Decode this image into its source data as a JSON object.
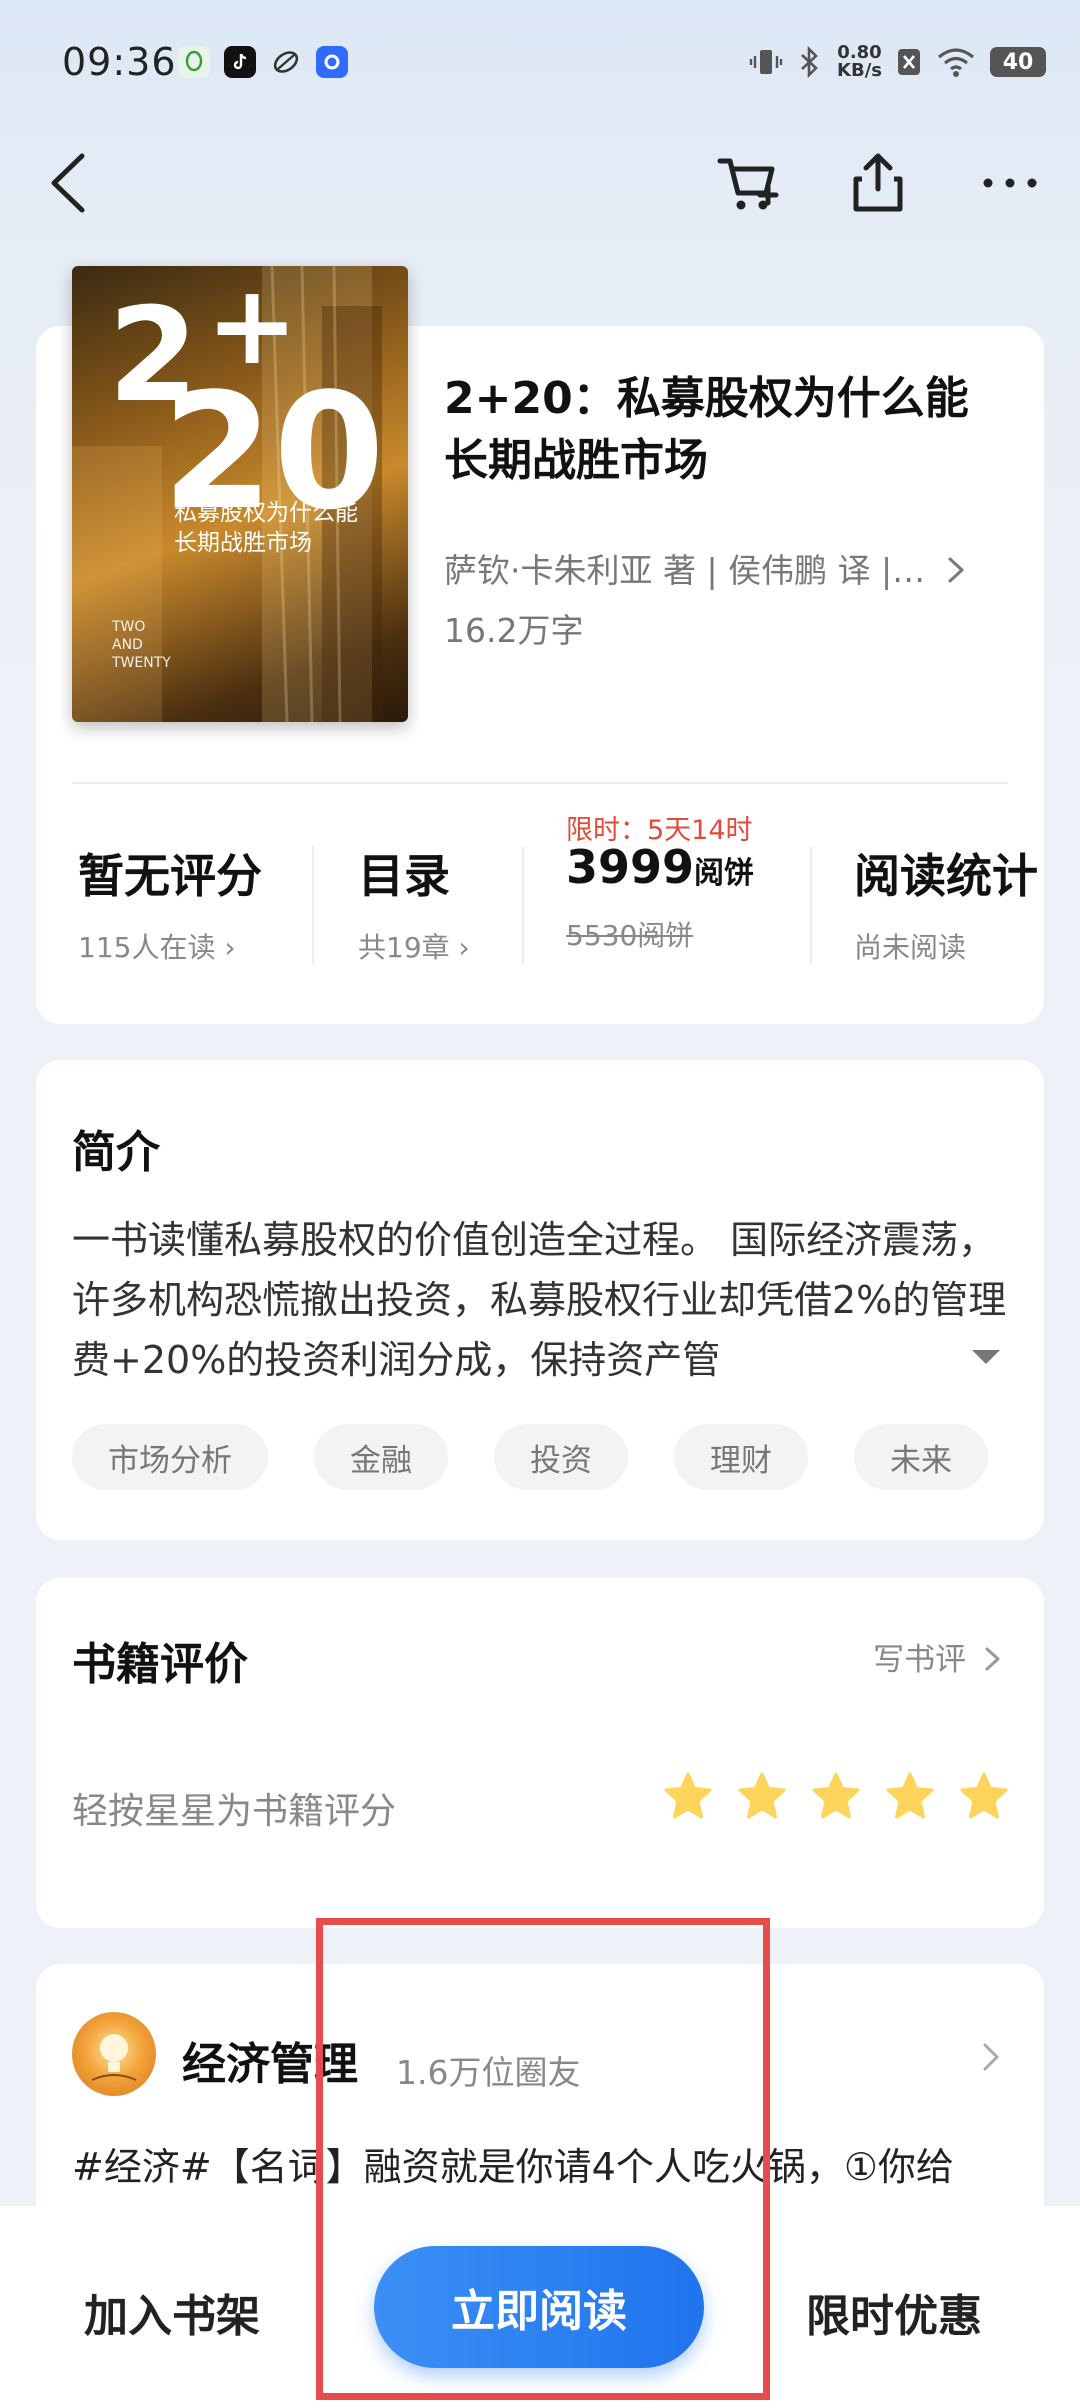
{
  "status_bar": {
    "time": "09:36",
    "net_speed_value": "0.80",
    "net_speed_unit": "KB/s",
    "battery": "40"
  },
  "book": {
    "cover_number_2": "2",
    "cover_plus": "+",
    "cover_number_20": "20",
    "cover_subtitle_line1": "私募股权为什么能",
    "cover_subtitle_line2": "长期战胜市场",
    "cover_en_line1": "TWO",
    "cover_en_line2": "AND",
    "cover_en_line3": "TWENTY",
    "title_line1": "2+20：私募股权为什么能",
    "title_line2": "长期战胜市场",
    "author": "萨钦·卡朱利亚 著 | 侯伟鹏 译 |…",
    "word_count": "16.2万字"
  },
  "stats": {
    "rating_label": "暂无评分",
    "readers": "115人在读",
    "toc_label": "目录",
    "chapters": "共19章",
    "promo": "限时：5天14时",
    "price": "3999",
    "price_unit": "阅饼",
    "original_price": "5530阅饼",
    "reading_stats_label": "阅读统计",
    "reading_status": "尚未阅读"
  },
  "intro": {
    "heading": "简介",
    "text": "一书读懂私募股权的价值创造全过程。 国际经济震荡，许多机构恐慌撤出投资，私募股权行业却凭借2%的管理费+20%的投资利润分成，保持资产管",
    "tags": [
      "市场分析",
      "金融",
      "投资",
      "理财",
      "未来"
    ]
  },
  "review": {
    "heading": "书籍评价",
    "write_review": "写书评",
    "rate_hint": "轻按星星为书籍评分",
    "stars": 5,
    "star_color": "#ffd45a"
  },
  "circle": {
    "name": "经济管理",
    "members": "1.6万位圈友",
    "post_preview": "#经济#【名词】融资就是你请4个人吃火锅，①你给"
  },
  "bottom_bar": {
    "add_shelf": "加入书架",
    "read_now": "立即阅读",
    "limited_offer": "限时优惠"
  },
  "colors": {
    "accent": "#1f74ee",
    "promo_red": "#e24a3a",
    "highlight_box": "#e84b4b"
  }
}
